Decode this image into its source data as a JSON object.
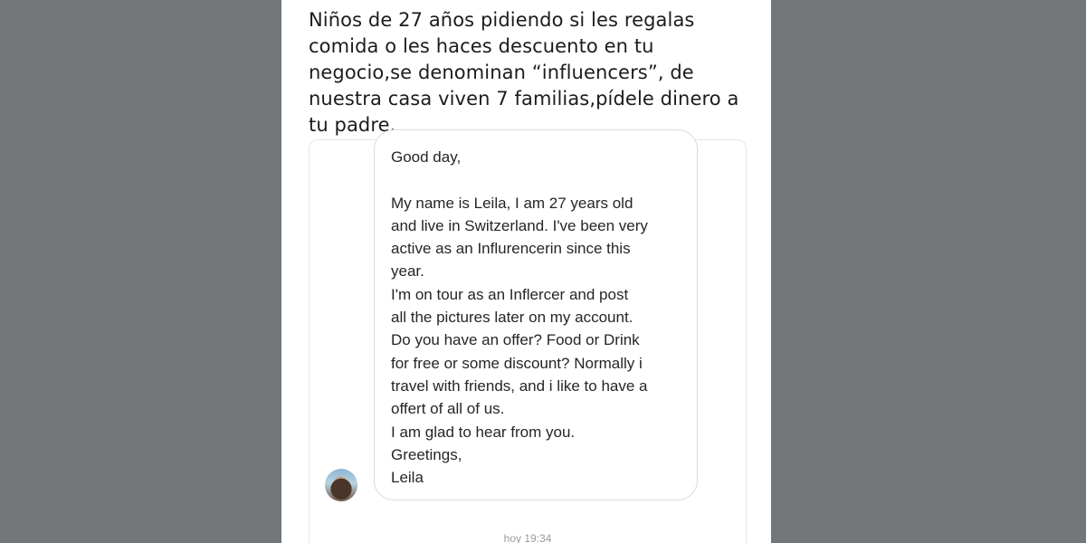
{
  "tweet": {
    "lines": [
      "Niños de 27 años pidiendo si les regalas",
      "comida o les haces descuento en tu",
      "negocio,se denominan “influencers”, de",
      "nuestra casa viven 7 familias,pídele dinero a",
      "tu padre."
    ]
  },
  "message": {
    "lines": [
      "Good day,",
      "",
      "My name is Leila, I am 27 years old",
      "and live in Switzerland. I've been very",
      "active as an Influrencerin since this",
      "year.",
      "I'm on tour as an Inflercer and post",
      "all the pictures later on my account.",
      "Do you have an offer? Food or Drink",
      "for free or some discount? Normally i",
      "travel with friends, and i like to have a",
      "offert of all of us.",
      "I am glad to hear from you.",
      "Greetings,",
      "Leila"
    ],
    "timestamp": "hoy 19:34"
  },
  "colors": {
    "background": "#737678",
    "panel": "#ffffff",
    "text": "#1c1c1c",
    "bubble_border": "#dbdbdb"
  }
}
